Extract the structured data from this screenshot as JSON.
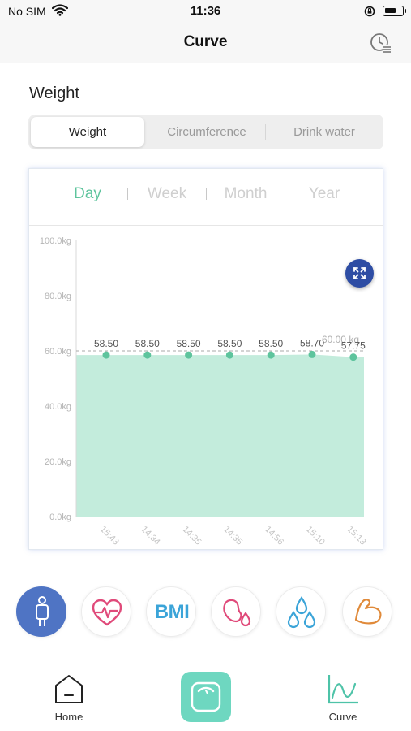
{
  "status": {
    "carrier": "No SIM",
    "time": "11:36"
  },
  "nav": {
    "title": "Curve",
    "history_icon": "history-clock-icon"
  },
  "section": {
    "title": "Weight"
  },
  "segments": [
    {
      "label": "Weight",
      "active": true
    },
    {
      "label": "Circumference",
      "active": false
    },
    {
      "label": "Drink water",
      "active": false
    }
  ],
  "periods": [
    {
      "label": "Day",
      "active": true
    },
    {
      "label": "Week",
      "active": false
    },
    {
      "label": "Month",
      "active": false
    },
    {
      "label": "Year",
      "active": false
    }
  ],
  "chart_data": {
    "type": "area",
    "y_ticks": [
      "100.0kg",
      "80.0kg",
      "60.0kg",
      "40.0kg",
      "20.0kg",
      "0.0kg"
    ],
    "ylim": [
      0,
      100
    ],
    "x": [
      "15:43",
      "14:34",
      "14:35",
      "14:35",
      "14:56",
      "15:10",
      "15:13"
    ],
    "values": [
      58.5,
      58.5,
      58.5,
      58.5,
      58.5,
      58.7,
      57.75
    ],
    "value_labels": [
      "58.50",
      "58.50",
      "58.50",
      "58.50",
      "58.50",
      "58.70",
      "57.75"
    ],
    "target": {
      "value": 60,
      "label": "60.00 kg"
    },
    "fill_color": "#c3ecdc",
    "point_color": "#5ec49d"
  },
  "metrics": [
    {
      "name": "body-icon",
      "active": true
    },
    {
      "name": "heart-rate-icon",
      "active": false
    },
    {
      "name": "bmi-icon",
      "label": "BMI",
      "active": false
    },
    {
      "name": "organ-drop-icon",
      "active": false
    },
    {
      "name": "water-drops-icon",
      "active": false
    },
    {
      "name": "muscle-arm-icon",
      "active": false
    }
  ],
  "tabbar": {
    "home_label": "Home",
    "curve_label": "Curve",
    "accent": "#6ed7c0"
  }
}
